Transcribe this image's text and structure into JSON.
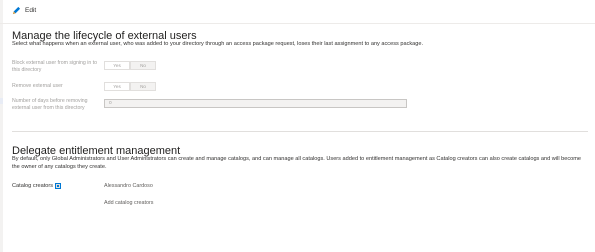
{
  "toolbar": {
    "edit_label": "Edit",
    "edit_icon": "pencil-icon",
    "accent": "#0078d4"
  },
  "lifecycle": {
    "title": "Manage the lifecycle of external users",
    "description": "Select what happens when an external user, who was added to your directory through an access package request, loses their last assignment to any access package.",
    "block_signin": {
      "label": "Block external user from signing in to this directory",
      "yes": "Yes",
      "no": "No",
      "selected": "No"
    },
    "remove_user": {
      "label": "Remove external user",
      "yes": "Yes",
      "no": "No",
      "selected": "No"
    },
    "days_before_removing": {
      "label": "Number of days before removing external user from this directory",
      "value": "0"
    }
  },
  "entitlement": {
    "title": "Delegate entitlement management",
    "description": "By default, only Global Administrators and User Administrators can create and manage catalogs, and can manage all catalogs. Users added to entitlement management as Catalog creators can also create catalogs and will become the owner of any catalogs they create.",
    "catalog_creators_label": "Catalog creators",
    "info_icon": "info-icon",
    "creator_name": "Alessandro Cardoso",
    "add_label": "Add catalog creators"
  }
}
